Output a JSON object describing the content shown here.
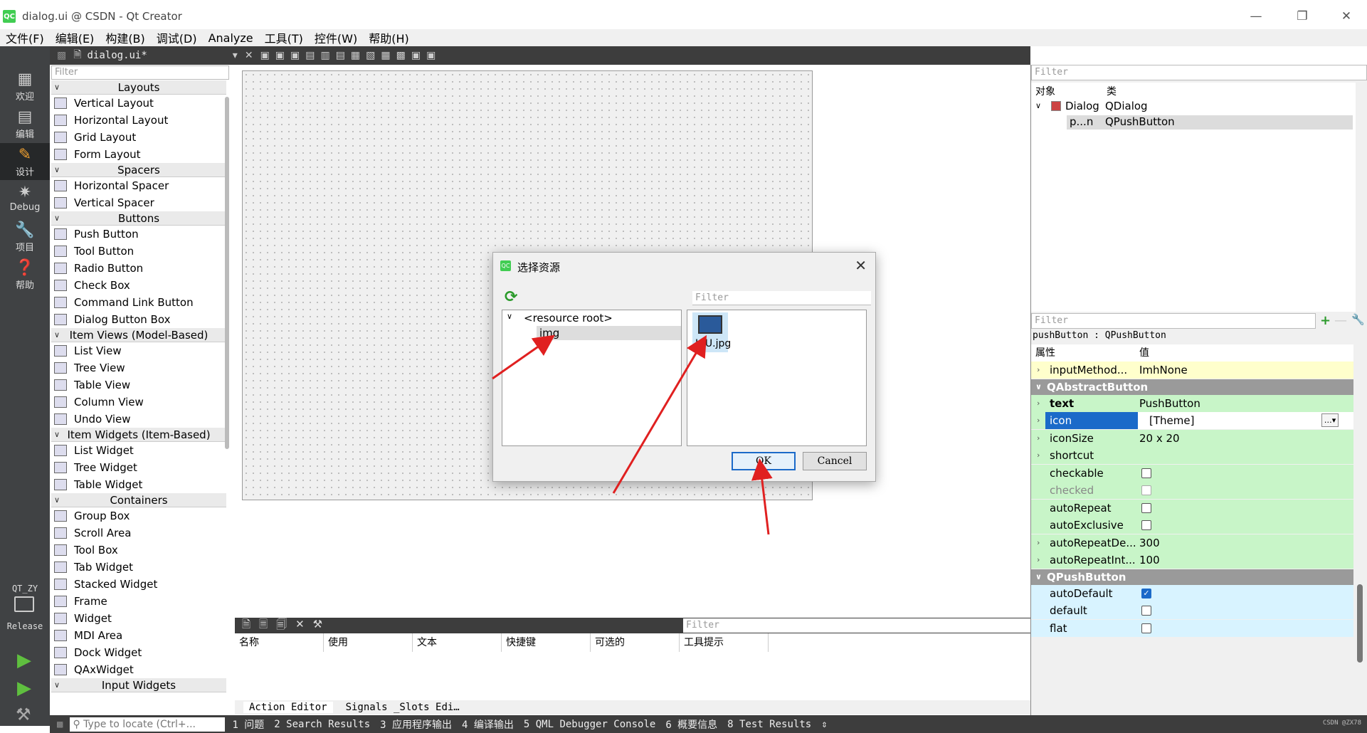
{
  "window": {
    "title": "dialog.ui @ CSDN - Qt Creator",
    "app_icon": "QC"
  },
  "menu": [
    "文件(F)",
    "编辑(E)",
    "构建(B)",
    "调试(D)",
    "Analyze",
    "工具(T)",
    "控件(W)",
    "帮助(H)"
  ],
  "modes": [
    {
      "label": "欢迎",
      "icon": "grid-icon"
    },
    {
      "label": "编辑",
      "icon": "edit-icon"
    },
    {
      "label": "设计",
      "icon": "pencil-icon"
    },
    {
      "label": "Debug",
      "icon": "bug-icon"
    },
    {
      "label": "项目",
      "icon": "wrench-icon"
    },
    {
      "label": "帮助",
      "icon": "help-icon"
    }
  ],
  "kit": {
    "project": "QT_ZY",
    "config": "Release"
  },
  "editor": {
    "filename": "dialog.ui*"
  },
  "widgetbox": {
    "filter": "Filter",
    "categories": [
      {
        "name": "Layouts",
        "items": [
          "Vertical Layout",
          "Horizontal Layout",
          "Grid Layout",
          "Form Layout"
        ]
      },
      {
        "name": "Spacers",
        "items": [
          "Horizontal Spacer",
          "Vertical Spacer"
        ]
      },
      {
        "name": "Buttons",
        "items": [
          "Push Button",
          "Tool Button",
          "Radio Button",
          "Check Box",
          "Command Link Button",
          "Dialog Button Box"
        ]
      },
      {
        "name": "Item Views (Model-Based)",
        "items": [
          "List View",
          "Tree View",
          "Table View",
          "Column View",
          "Undo View"
        ]
      },
      {
        "name": "Item Widgets (Item-Based)",
        "items": [
          "List Widget",
          "Tree Widget",
          "Table Widget"
        ]
      },
      {
        "name": "Containers",
        "items": [
          "Group Box",
          "Scroll Area",
          "Tool Box",
          "Tab Widget",
          "Stacked Widget",
          "Frame",
          "Widget",
          "MDI Area",
          "Dock Widget",
          "QAxWidget"
        ]
      },
      {
        "name": "Input Widgets",
        "items": []
      }
    ]
  },
  "dialog": {
    "title": "选择资源",
    "filter": "Filter",
    "tree": [
      "<resource root>",
      "img"
    ],
    "file": "ICU.jpg",
    "ok": "OK",
    "cancel": "Cancel"
  },
  "action_editor": {
    "filter": "Filter",
    "columns": [
      "名称",
      "使用",
      "文本",
      "快捷键",
      "可选的",
      "工具提示"
    ],
    "tabs": [
      "Action Editor",
      "Signals _Slots Edi…"
    ]
  },
  "status": {
    "locate_placeholder": "Type to locate (Ctrl+...",
    "panes": [
      "1 问题",
      "2 Search Results",
      "3 应用程序输出",
      "4 编译输出",
      "5 QML Debugger Console",
      "6 概要信息",
      "8 Test Results"
    ]
  },
  "object_inspector": {
    "filter": "Filter",
    "col_object": "对象",
    "col_class": "类",
    "rows": [
      {
        "name": "Dialog",
        "class": "QDialog"
      },
      {
        "name": "p...n",
        "class": "QPushButton"
      }
    ]
  },
  "property_editor": {
    "filter": "Filter",
    "object_label": "pushButton : QPushButton",
    "col_prop": "属性",
    "col_value": "值",
    "rows": [
      {
        "kind": "prop",
        "name": "inputMethod...",
        "value": "ImhNone",
        "bg": "#ffffcc"
      },
      {
        "kind": "head",
        "name": "QAbstractButton"
      },
      {
        "kind": "prop",
        "name": "text",
        "value": "PushButton",
        "bg": "#c8f5c8",
        "bold": true
      },
      {
        "kind": "prop",
        "name": "icon",
        "value": "[Theme]",
        "bg": "#c8f5c8",
        "selected": true
      },
      {
        "kind": "prop",
        "name": "iconSize",
        "value": "20 x 20",
        "bg": "#c8f5c8"
      },
      {
        "kind": "prop",
        "name": "shortcut",
        "value": "",
        "bg": "#c8f5c8"
      },
      {
        "kind": "check",
        "name": "checkable",
        "checked": false,
        "bg": "#c8f5c8"
      },
      {
        "kind": "check",
        "name": "checked",
        "checked": false,
        "bg": "#c8f5c8",
        "disabled": true
      },
      {
        "kind": "check",
        "name": "autoRepeat",
        "checked": false,
        "bg": "#c8f5c8"
      },
      {
        "kind": "check",
        "name": "autoExclusive",
        "checked": false,
        "bg": "#c8f5c8"
      },
      {
        "kind": "prop",
        "name": "autoRepeatDe...",
        "value": "300",
        "bg": "#c8f5c8"
      },
      {
        "kind": "prop",
        "name": "autoRepeatInt...",
        "value": "100",
        "bg": "#c8f5c8"
      },
      {
        "kind": "head",
        "name": "QPushButton"
      },
      {
        "kind": "check",
        "name": "autoDefault",
        "checked": true,
        "bg": "#d8f3ff"
      },
      {
        "kind": "check",
        "name": "default",
        "checked": false,
        "bg": "#d8f3ff"
      },
      {
        "kind": "check",
        "name": "flat",
        "checked": false,
        "bg": "#d8f3ff"
      }
    ]
  },
  "watermark": "CSDN @ZX78"
}
